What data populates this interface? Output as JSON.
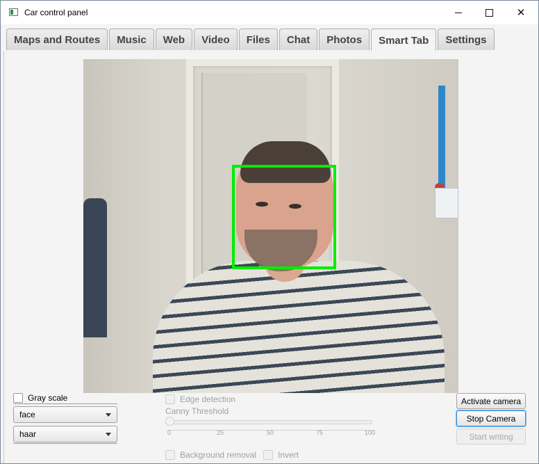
{
  "window": {
    "title": "Car control panel",
    "minimize_label": "",
    "maximize_label": "",
    "close_label": "✕"
  },
  "tabs": [
    {
      "label": "Maps and Routes"
    },
    {
      "label": "Music"
    },
    {
      "label": "Web"
    },
    {
      "label": "Video"
    },
    {
      "label": "Files"
    },
    {
      "label": "Chat"
    },
    {
      "label": "Photos"
    },
    {
      "label": "Smart Tab",
      "active": true
    },
    {
      "label": "Settings"
    }
  ],
  "camera": {
    "detection": "face"
  },
  "controls": {
    "gray_scale": {
      "label": "Gray scale",
      "checked": false
    },
    "detection_select": {
      "value": "face"
    },
    "classifier_select": {
      "value": "haar"
    },
    "edge_detection": {
      "label": "Edge detection",
      "checked": false,
      "enabled": false
    },
    "canny_threshold": {
      "label": "Canny Threshold",
      "value": 0,
      "ticks": [
        "0",
        "25",
        "50",
        "75",
        "100"
      ],
      "enabled": false
    },
    "background_removal": {
      "label": "Background removal",
      "checked": false,
      "enabled": false
    },
    "invert": {
      "label": "Invert",
      "checked": false,
      "enabled": false
    }
  },
  "buttons": {
    "activate_camera": "Activate camera",
    "stop_camera": "Stop Camera",
    "start_writing": "Start writing"
  },
  "colors": {
    "face_box": "#00ee00",
    "focus": "#3a8fd8"
  }
}
